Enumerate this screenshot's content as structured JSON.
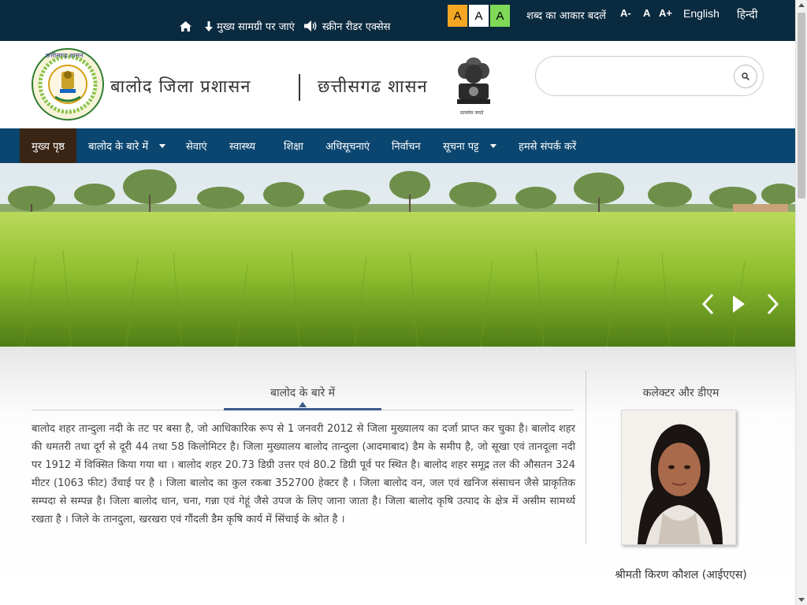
{
  "topbar": {
    "skip_to_content": "मुख्य सामग्री पर जाएं",
    "screen_reader": "स्क्रीन रीडर एक्सेस",
    "contrast": [
      {
        "label": "A",
        "bg": "#f5a623",
        "fg": "#000000"
      },
      {
        "label": "A",
        "bg": "#ffffff",
        "fg": "#000000"
      },
      {
        "label": "A",
        "bg": "#7ed957",
        "fg": "#000000"
      }
    ],
    "font_size_label": "शब्द का आकार बदलें",
    "font_decrease": "A-",
    "font_normal": "A",
    "font_increase": "A+",
    "lang_english": "English",
    "lang_hindi": "हिन्दी"
  },
  "header": {
    "title": "बालोद जिला प्रशासन",
    "subtitle": "छत्तीसगढ शासन",
    "logo_text": "छत्तीसगढ़ शासन",
    "emblem_text": "सत्यमेव जयते",
    "search_placeholder": ""
  },
  "nav": {
    "items": [
      {
        "label": "मुख्य पृष्ठ",
        "active": true
      },
      {
        "label": "बालोद के बारे में",
        "dropdown": true
      },
      {
        "label": "सेवाएं"
      },
      {
        "label": "स्वास्थ्य"
      },
      {
        "label": "शिक्षा"
      },
      {
        "label": "अधिसूचनाएं"
      },
      {
        "label": "निर्वाचन"
      },
      {
        "label": "सूचना पट्ट",
        "dropdown": true
      },
      {
        "label": "हमसे संपर्क करें"
      }
    ]
  },
  "about": {
    "title": "बालोद के बारे में",
    "text": "बालोद शहर तान्दुला नदी के तट पर बसा है, जो आधिकारिक रूप से 1 जनवरी 2012 से जिला मुख्यालय का दर्जा प्राप्त कर चुका है। बालोद शहर की धमतरी तथा दूर्ग से दूरी 44 तथा 58 किलोमिटर है। जिला मुख्यालय बालोद तान्दुला (आदमाबाद) डैम के समीप है, जो सूखा एवं तानदूला नदी पर 1912 में विक्सित किया गया था । बालोद शहर 20.73 डिग्री उत्तर एवं 80.2 डिग्री पूर्व पर स्थित है। बालोद शहर समूद्र तल की औसतन 324 मीटर (1063 फीट) उँचाई पर है । जिला बालोद का कुल रकबा 352700 हेक्टर है । जिला बालोद वन, जल एवं खनिज संसाधन जैसे प्राकृतिक सम्पदा से सम्पन्न है। जिला बालोद धान, चना, गन्ना एवं गेहूं जैसे उपज के लिए जाना जाता है। जिला बालोद कृषि उत्पाद के क्षेत्र में असीम सामर्थ्य रखता है । जिले के तानदुला, खरखरा एवं गौंदली डैम कृषि कार्य में सिंचाई के श्रोत है ।"
  },
  "collector": {
    "title": "कलेक्टर और डीएम",
    "name": "श्रीमती किरण कौशल (आईएएस)"
  },
  "colors": {
    "topbar": "#0a2a3f",
    "nav": "#0b4670",
    "nav_active": "#3a2414",
    "accent": "#3c5a8a"
  }
}
